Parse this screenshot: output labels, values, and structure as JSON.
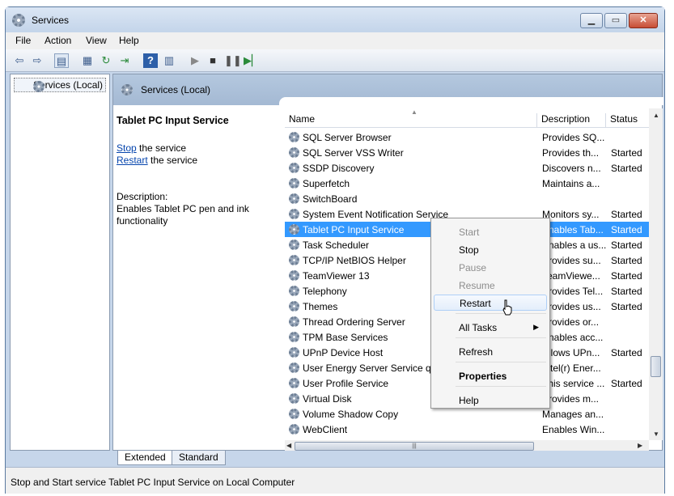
{
  "window": {
    "title": "Services"
  },
  "menu": [
    "File",
    "Action",
    "View",
    "Help"
  ],
  "tree": {
    "root_label": "Services (Local)"
  },
  "header": {
    "title": "Services (Local)"
  },
  "desc": {
    "service_name": "Tablet PC Input Service",
    "stop_link": "Stop",
    "stop_suffix": " the service",
    "restart_link": "Restart",
    "restart_suffix": " the service",
    "desc_label": "Description:",
    "desc_text": "Enables Tablet PC pen and ink functionality"
  },
  "columns": {
    "name": "Name",
    "description": "Description",
    "status": "Status"
  },
  "rows": [
    {
      "name": "SQL Server Browser",
      "desc": "Provides SQ...",
      "status": ""
    },
    {
      "name": "SQL Server VSS Writer",
      "desc": "Provides th...",
      "status": "Started"
    },
    {
      "name": "SSDP Discovery",
      "desc": "Discovers n...",
      "status": "Started"
    },
    {
      "name": "Superfetch",
      "desc": "Maintains a...",
      "status": ""
    },
    {
      "name": "SwitchBoard",
      "desc": "",
      "status": ""
    },
    {
      "name": "System Event Notification Service",
      "desc": "Monitors sy...",
      "status": "Started"
    },
    {
      "name": "Tablet PC Input Service",
      "desc": "Enables Tab...",
      "status": "Started"
    },
    {
      "name": "Task Scheduler",
      "desc": "Enables a us...",
      "status": "Started"
    },
    {
      "name": "TCP/IP NetBIOS Helper",
      "desc": "Provides su...",
      "status": "Started"
    },
    {
      "name": "TeamViewer 13",
      "desc": "TeamViewe...",
      "status": "Started"
    },
    {
      "name": "Telephony",
      "desc": "Provides Tel...",
      "status": "Started"
    },
    {
      "name": "Themes",
      "desc": "Provides us...",
      "status": "Started"
    },
    {
      "name": "Thread Ordering Server",
      "desc": "Provides or...",
      "status": ""
    },
    {
      "name": "TPM Base Services",
      "desc": "Enables acc...",
      "status": ""
    },
    {
      "name": "UPnP Device Host",
      "desc": "Allows UPn...",
      "status": "Started"
    },
    {
      "name": "User Energy Server Service que",
      "desc": "Intel(r) Ener...",
      "status": ""
    },
    {
      "name": "User Profile Service",
      "desc": "This service ...",
      "status": "Started"
    },
    {
      "name": "Virtual Disk",
      "desc": "Provides m...",
      "status": ""
    },
    {
      "name": "Volume Shadow Copy",
      "desc": "Manages an...",
      "status": ""
    },
    {
      "name": "WebClient",
      "desc": "Enables Win...",
      "status": ""
    }
  ],
  "selected_row": "Tablet PC Input Service",
  "context_menu": [
    {
      "label": "Start",
      "disabled": true
    },
    {
      "label": "Stop",
      "disabled": false
    },
    {
      "label": "Pause",
      "disabled": true
    },
    {
      "label": "Resume",
      "disabled": true
    },
    {
      "label": "Restart",
      "disabled": false,
      "hover": true
    },
    {
      "label": "All Tasks",
      "disabled": false,
      "submenu": true
    },
    {
      "label": "Refresh",
      "disabled": false
    },
    {
      "label": "Properties",
      "disabled": false,
      "bold": true
    },
    {
      "label": "Help",
      "disabled": false
    }
  ],
  "tabs": [
    "Extended",
    "Standard"
  ],
  "status_bar": "Stop and Start service Tablet PC Input Service on Local Computer",
  "colors": {
    "selection": "#3399ff",
    "header_band": "#b4c8df",
    "link": "#0645ad"
  }
}
